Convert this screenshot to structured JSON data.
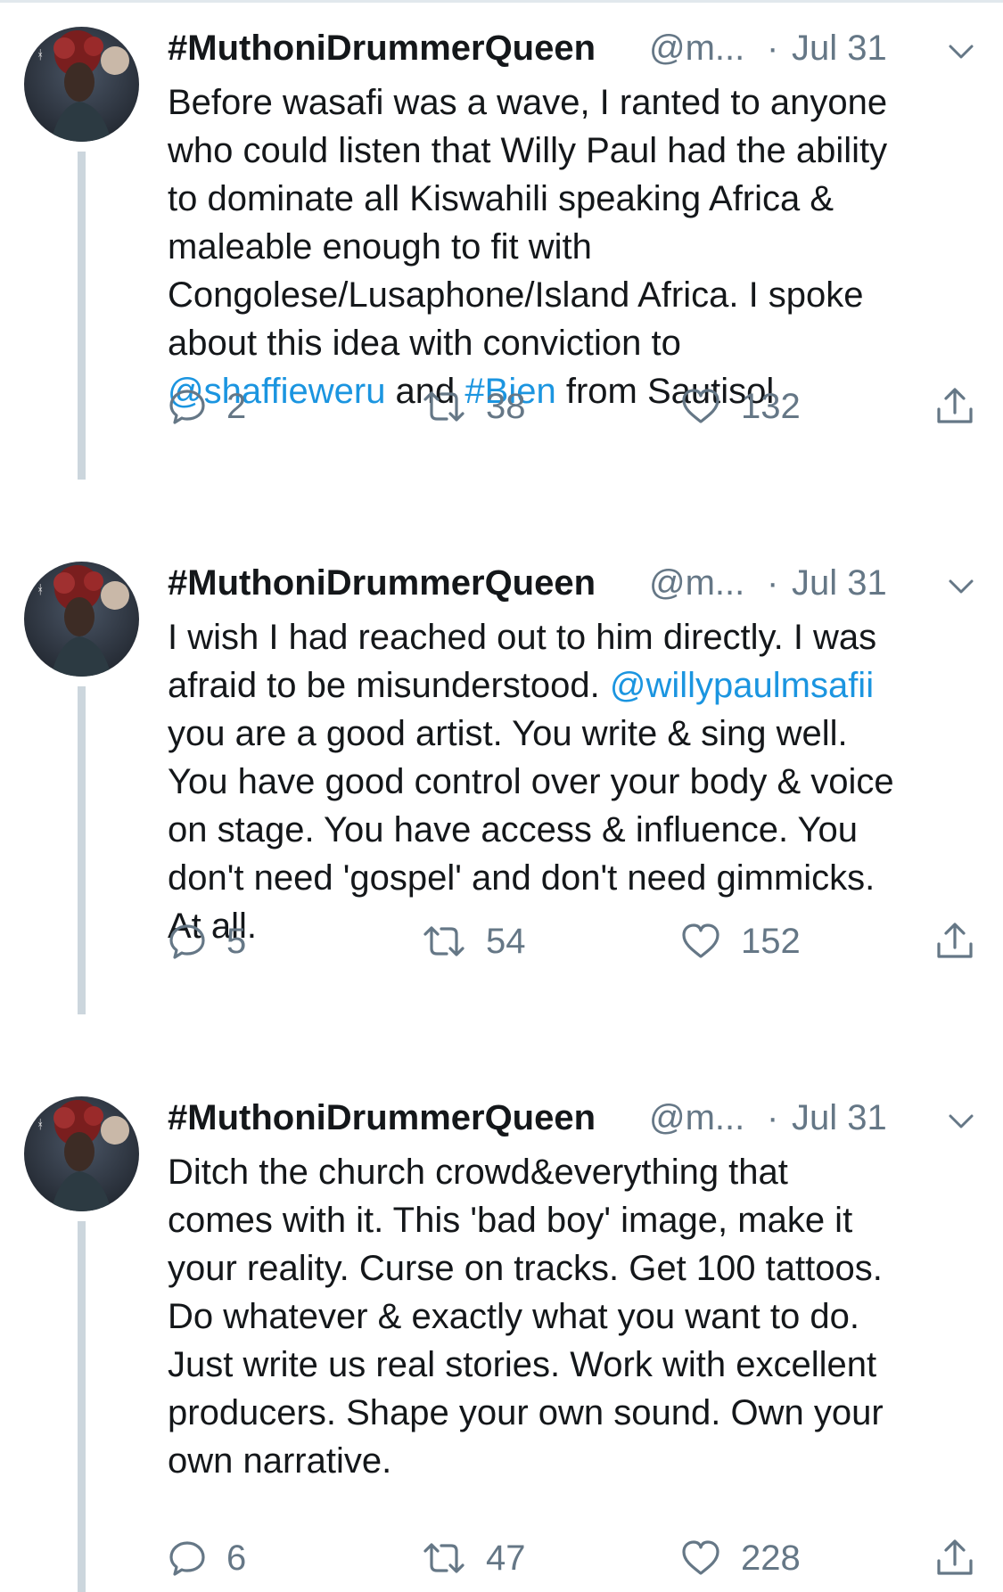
{
  "tweets": [
    {
      "name": "#MuthoniDrummerQueen",
      "handle": "@m...",
      "dot": "·",
      "date": "Jul 31",
      "text_lines": [
        [
          {
            "t": "Before wasafi was a wave, I ranted to anyone"
          }
        ],
        [
          {
            "t": "who could listen that Willy Paul had the ability"
          }
        ],
        [
          {
            "t": "to dominate all Kiswahili speaking Africa &"
          }
        ],
        [
          {
            "t": "maleable enough to fit with"
          }
        ],
        [
          {
            "t": "Congolese/Lusaphone/Island Africa. I spoke"
          }
        ],
        [
          {
            "t": "about this idea with conviction to"
          }
        ],
        [
          {
            "t": "@shaffieweru",
            "link": true
          },
          {
            "t": " and "
          },
          {
            "t": "#Bien",
            "link": true
          },
          {
            "t": " from Sautisol"
          }
        ]
      ],
      "replies": "2",
      "retweets": "38",
      "likes": "132"
    },
    {
      "name": "#MuthoniDrummerQueen",
      "handle": "@m...",
      "dot": "·",
      "date": "Jul 31",
      "text_lines": [
        [
          {
            "t": "I wish I had reached out to him directly. I was"
          }
        ],
        [
          {
            "t": "afraid to be misunderstood. "
          },
          {
            "t": "@willypaulmsafii",
            "link": true
          }
        ],
        [
          {
            "t": "you are a good artist. You write & sing well."
          }
        ],
        [
          {
            "t": "You have good control over your body & voice"
          }
        ],
        [
          {
            "t": "on stage. You have access & influence. You"
          }
        ],
        [
          {
            "t": "don't need 'gospel' and don't need gimmicks."
          }
        ],
        [
          {
            "t": "At all."
          }
        ]
      ],
      "replies": "5",
      "retweets": "54",
      "likes": "152"
    },
    {
      "name": "#MuthoniDrummerQueen",
      "handle": "@m...",
      "dot": "·",
      "date": "Jul 31",
      "text_lines": [
        [
          {
            "t": "Ditch the church crowd&everything that"
          }
        ],
        [
          {
            "t": "comes with it. This 'bad boy' image, make it"
          }
        ],
        [
          {
            "t": "your reality. Curse on tracks. Get 100 tattoos."
          }
        ],
        [
          {
            "t": "Do whatever & exactly what you want to do."
          }
        ],
        [
          {
            "t": "Just write us real stories. Work with excellent"
          }
        ],
        [
          {
            "t": "producers. Shape your own sound. Own your"
          }
        ],
        [
          {
            "t": "own narrative."
          }
        ]
      ],
      "replies": "6",
      "retweets": "47",
      "likes": "228"
    }
  ],
  "colors": {
    "text": "#14171a",
    "secondary": "#657786",
    "link": "#1b95e0",
    "thread_line": "#ccd6dd"
  },
  "icons": {
    "reply": "speech-bubble-icon",
    "retweet": "retweet-arrows-icon",
    "like": "heart-icon",
    "share": "share-upload-icon",
    "menu": "chevron-down-icon"
  }
}
